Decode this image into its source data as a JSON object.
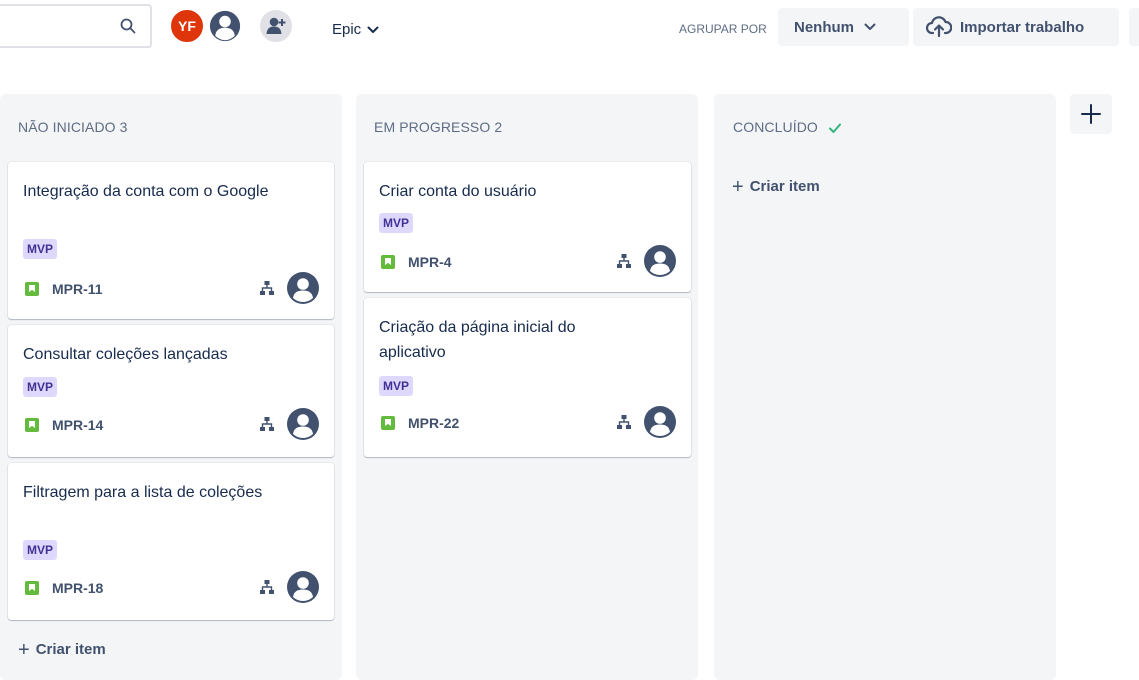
{
  "toolbar": {
    "search_placeholder": "",
    "avatars": [
      {
        "initials": "YF",
        "color": "#de350b"
      },
      {
        "initials": "",
        "color": "#ffffff"
      }
    ],
    "epic_label": "Epic",
    "group_by_label": "AGRUPAR POR",
    "group_by_value": "Nenhum",
    "import_label": "Importar trabalho"
  },
  "columns": [
    {
      "title": "NÃO INICIADO 3",
      "cards": [
        {
          "title": "Integração da conta com o Google",
          "label": "MVP",
          "key": "MPR-11"
        },
        {
          "title": "Consultar coleções lançadas",
          "label": "MVP",
          "key": "MPR-14"
        },
        {
          "title": "Filtragem para a lista de coleções",
          "label": "MVP",
          "key": "MPR-18"
        }
      ],
      "create_label": "Criar item"
    },
    {
      "title": "EM PROGRESSO 2",
      "cards": [
        {
          "title": "Criar conta do usuário",
          "label": "MVP",
          "key": "MPR-4"
        },
        {
          "title": "Criação da página inicial do aplicativo",
          "label": "MVP",
          "key": "MPR-22"
        }
      ]
    },
    {
      "title": "CONCLUÍDO",
      "cards": [],
      "create_label": "Criar item"
    }
  ],
  "colors": {
    "accent_red": "#de350b",
    "label_bg": "#dfd8fd",
    "label_text": "#403294",
    "story_green": "#63ba3c",
    "check_green": "#36b37e",
    "column_bg": "#f4f5f7"
  }
}
